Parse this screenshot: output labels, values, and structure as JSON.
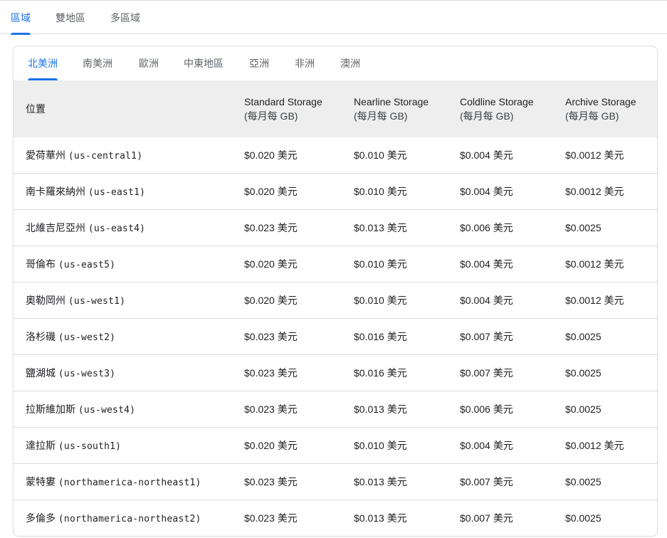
{
  "top_tabs": [
    {
      "label": "區域",
      "active": true
    },
    {
      "label": "雙地區",
      "active": false
    },
    {
      "label": "多區域",
      "active": false
    }
  ],
  "sub_tabs": [
    {
      "label": "北美洲",
      "active": true
    },
    {
      "label": "南美洲",
      "active": false
    },
    {
      "label": "歐洲",
      "active": false
    },
    {
      "label": "中東地區",
      "active": false
    },
    {
      "label": "亞洲",
      "active": false
    },
    {
      "label": "非洲",
      "active": false
    },
    {
      "label": "澳洲",
      "active": false
    }
  ],
  "table": {
    "headers": {
      "location": "位置",
      "standard": {
        "title": "Standard Storage",
        "unit": "(每月每 GB)"
      },
      "nearline": {
        "title": "Nearline Storage",
        "unit": "(每月每 GB)"
      },
      "coldline": {
        "title": "Coldline Storage",
        "unit": "(每月每 GB)"
      },
      "archive": {
        "title": "Archive Storage",
        "unit": "(每月每 GB)"
      }
    },
    "rows": [
      {
        "name": "愛荷華州",
        "code": "(us-central1)",
        "standard": "$0.020 美元",
        "nearline": "$0.010 美元",
        "coldline": "$0.004 美元",
        "archive": "$0.0012 美元"
      },
      {
        "name": "南卡羅來納州",
        "code": "(us-east1)",
        "standard": "$0.020 美元",
        "nearline": "$0.010 美元",
        "coldline": "$0.004 美元",
        "archive": "$0.0012 美元"
      },
      {
        "name": "北維吉尼亞州",
        "code": "(us-east4)",
        "standard": "$0.023 美元",
        "nearline": "$0.013 美元",
        "coldline": "$0.006 美元",
        "archive": "$0.0025"
      },
      {
        "name": "哥倫布",
        "code": "(us-east5)",
        "standard": "$0.020 美元",
        "nearline": "$0.010 美元",
        "coldline": "$0.004 美元",
        "archive": "$0.0012 美元"
      },
      {
        "name": "奧勒岡州",
        "code": "(us-west1)",
        "standard": "$0.020 美元",
        "nearline": "$0.010 美元",
        "coldline": "$0.004 美元",
        "archive": "$0.0012 美元"
      },
      {
        "name": "洛杉磯",
        "code": "(us-west2)",
        "standard": "$0.023 美元",
        "nearline": "$0.016 美元",
        "coldline": "$0.007 美元",
        "archive": "$0.0025"
      },
      {
        "name": "鹽湖城",
        "code": "(us-west3)",
        "standard": "$0.023 美元",
        "nearline": "$0.016 美元",
        "coldline": "$0.007 美元",
        "archive": "$0.0025"
      },
      {
        "name": "拉斯維加斯",
        "code": "(us-west4)",
        "standard": "$0.023 美元",
        "nearline": "$0.013 美元",
        "coldline": "$0.006 美元",
        "archive": "$0.0025"
      },
      {
        "name": "達拉斯",
        "code": "(us-south1)",
        "standard": "$0.020 美元",
        "nearline": "$0.010 美元",
        "coldline": "$0.004 美元",
        "archive": "$0.0012 美元"
      },
      {
        "name": "蒙特婁",
        "code": "(northamerica-northeast1)",
        "standard": "$0.023 美元",
        "nearline": "$0.013 美元",
        "coldline": "$0.007 美元",
        "archive": "$0.0025"
      },
      {
        "name": "多倫多",
        "code": "(northamerica-northeast2)",
        "standard": "$0.023 美元",
        "nearline": "$0.013 美元",
        "coldline": "$0.007 美元",
        "archive": "$0.0025"
      }
    ]
  }
}
